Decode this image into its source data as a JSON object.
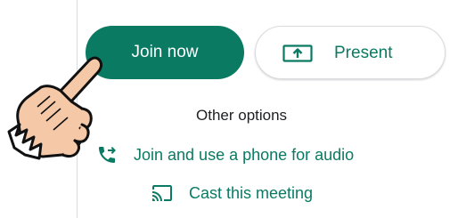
{
  "buttons": {
    "join_label": "Join now",
    "present_label": "Present"
  },
  "other_options": {
    "heading": "Other options",
    "phone_label": "Join and use a phone for audio",
    "cast_label": "Cast this meeting"
  },
  "icons": {
    "present": "present-screen-icon",
    "phone": "phone-forwarded-icon",
    "cast": "cast-icon",
    "pointer": "pointing-hand-cursor"
  },
  "colors": {
    "accent": "#0b7a63",
    "border": "#dadce0",
    "text": "#202124",
    "hand_skin": "#f5c9a8"
  }
}
